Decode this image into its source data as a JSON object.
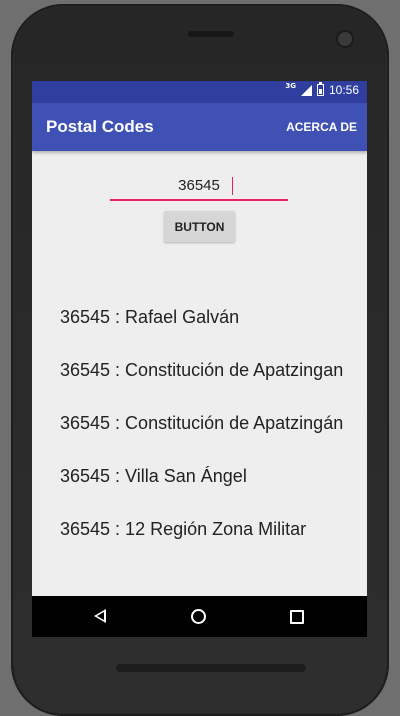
{
  "status_bar": {
    "network": "3G",
    "time": "10:56"
  },
  "app_bar": {
    "title": "Postal Codes",
    "action": "ACERCA DE"
  },
  "search": {
    "value": "36545"
  },
  "button": {
    "label": "BUTTON"
  },
  "results": [
    "36545 : Rafael Galván",
    "36545 : Constitución de Apatzingan",
    "36545 : Constitución de Apatzingán",
    "36545 : Villa San Ángel",
    "36545 : 12 Región Zona Militar"
  ],
  "nav_bar": {
    "icons": [
      "back-icon",
      "home-icon",
      "recents-icon"
    ]
  },
  "colors": {
    "primary": "#3f51b5",
    "primary_dark": "#303f9f",
    "accent": "#e91e63",
    "background": "#eeeeee"
  }
}
